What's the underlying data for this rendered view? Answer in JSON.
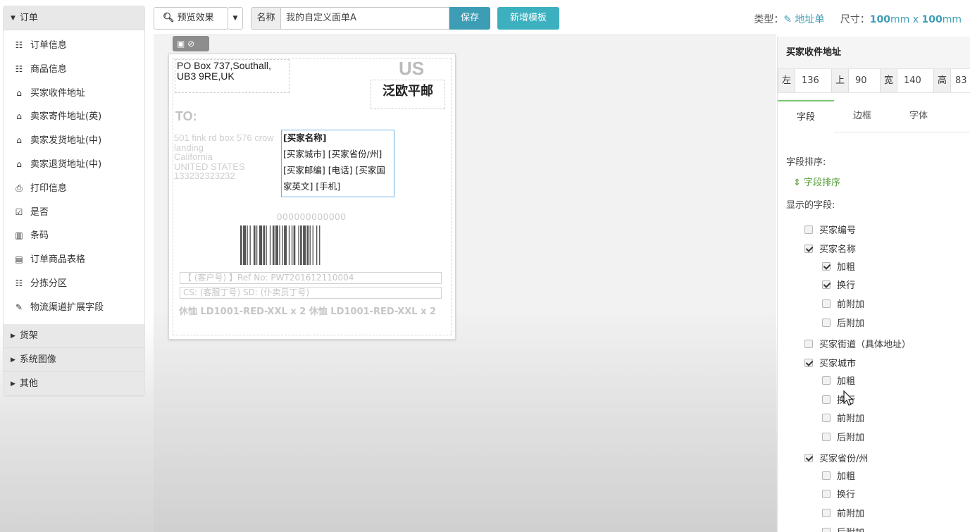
{
  "sidebar": {
    "groups": [
      {
        "label": "订单",
        "expanded": true,
        "items": [
          {
            "icon": "list-icon",
            "glyph": "☷",
            "label": "订单信息"
          },
          {
            "icon": "list-icon",
            "glyph": "☷",
            "label": "商品信息"
          },
          {
            "icon": "home-icon",
            "glyph": "⌂",
            "label": "买家收件地址"
          },
          {
            "icon": "home-icon",
            "glyph": "⌂",
            "label": "卖家寄件地址(英)"
          },
          {
            "icon": "home-icon",
            "glyph": "⌂",
            "label": "卖家发货地址(中)"
          },
          {
            "icon": "home-icon",
            "glyph": "⌂",
            "label": "卖家退货地址(中)"
          },
          {
            "icon": "print-icon",
            "glyph": "⎙",
            "label": "打印信息"
          },
          {
            "icon": "checkbox-icon",
            "glyph": "☑",
            "label": "是否"
          },
          {
            "icon": "barcode-icon",
            "glyph": "▥",
            "label": "条码"
          },
          {
            "icon": "table-icon",
            "glyph": "▤",
            "label": "订单商品表格"
          },
          {
            "icon": "list-icon",
            "glyph": "☷",
            "label": "分拣分区"
          },
          {
            "icon": "edit-icon",
            "glyph": "✎",
            "label": "物流渠道扩展字段"
          }
        ]
      },
      {
        "label": "货架",
        "expanded": false,
        "items": []
      },
      {
        "label": "系统图像",
        "expanded": false,
        "items": []
      },
      {
        "label": "其他",
        "expanded": false,
        "items": []
      }
    ]
  },
  "toolbar": {
    "preview_label": "预览效果",
    "name_label": "名称",
    "name_value": "我的自定义面单A",
    "save_label": "保存",
    "new_template_label": "新增模板",
    "type_label": "类型：",
    "type_value": "地址单",
    "size_label": "尺寸：",
    "size_w": "100",
    "size_h": "100",
    "size_unit": "mm",
    "size_x": " x "
  },
  "label": {
    "sender": "PO Box 737,Southall, UB3 9RE,UK",
    "country": "US",
    "service": "泛欧平邮",
    "to": "TO:",
    "recipient_lines": [
      "501 fink rd box 576 crow",
      "landing",
      "California",
      "UNITED STATES",
      "133232323232"
    ],
    "selected_fields": [
      "[买家名称]",
      "[买家城市] [买家省份/州]",
      "[买家邮编] [电话] [买家国",
      "家英文] [手机]"
    ],
    "barcode_number": "000000000000",
    "ref_line": "【  (客户号)  】Ref No:   PWT201612110004",
    "cs_line": "CS:  (客服丁号)          SD:  (仆卖员丁号)",
    "sku_line": "休恤 LD1001-RED-XXL x 2 休恤 LD1001-RED-XXL x 2"
  },
  "panel": {
    "title": "买家收件地址",
    "position": {
      "left_label": "左",
      "left": "136",
      "top_label": "上",
      "top": "90",
      "width_label": "宽",
      "width": "140",
      "height_label": "高",
      "height": "83"
    },
    "tabs": [
      "字段",
      "边框",
      "字体"
    ],
    "active_tab": "字段",
    "sort_label": "字段排序:",
    "sort_link": "字段排序",
    "show_label": "显示的字段:",
    "fields": [
      {
        "label": "买家编号",
        "checked": false,
        "level": 0
      },
      {
        "label": "买家名称",
        "checked": true,
        "level": 0
      },
      {
        "label": "加粗",
        "checked": true,
        "level": 1
      },
      {
        "label": "换行",
        "checked": true,
        "level": 1
      },
      {
        "label": "前附加",
        "checked": false,
        "level": 1
      },
      {
        "label": "后附加",
        "checked": false,
        "level": 1
      },
      {
        "label": "买家街道（具体地址）",
        "checked": false,
        "level": 0
      },
      {
        "label": "买家城市",
        "checked": true,
        "level": 0
      },
      {
        "label": "加粗",
        "checked": false,
        "level": 1
      },
      {
        "label": "换行",
        "checked": false,
        "level": 1
      },
      {
        "label": "前附加",
        "checked": false,
        "level": 1
      },
      {
        "label": "后附加",
        "checked": false,
        "level": 1
      },
      {
        "label": "买家省份/州",
        "checked": true,
        "level": 0
      },
      {
        "label": "加粗",
        "checked": false,
        "level": 1
      },
      {
        "label": "换行",
        "checked": false,
        "level": 1
      },
      {
        "label": "前附加",
        "checked": false,
        "level": 1
      },
      {
        "label": "后附加",
        "checked": false,
        "level": 1
      }
    ]
  },
  "colors": {
    "accent": "#3d9db5",
    "new_button": "#3cb0be",
    "tab_active": "#7cc576",
    "selection": "#6eb2e2"
  }
}
